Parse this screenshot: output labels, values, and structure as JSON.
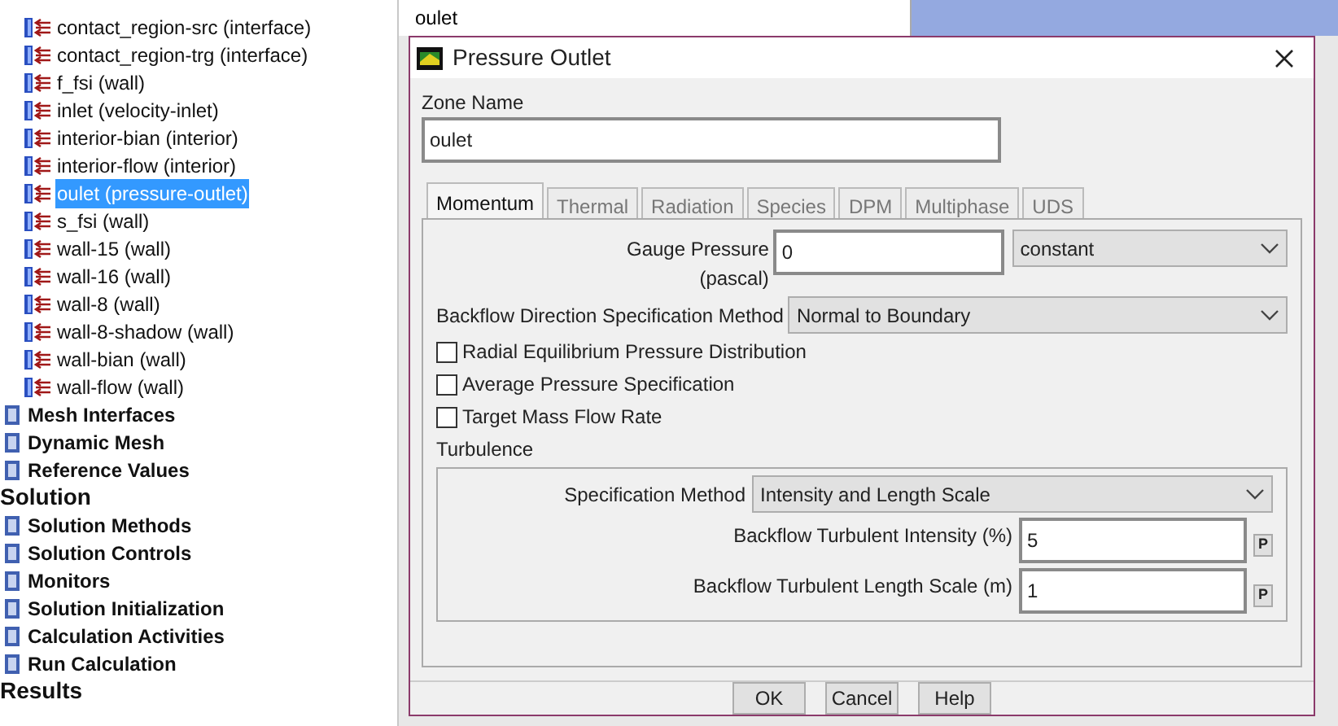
{
  "tree": {
    "items": [
      {
        "kind": "zone",
        "label": "contact_region-src (interface)",
        "selected": false
      },
      {
        "kind": "zone",
        "label": "contact_region-trg (interface)",
        "selected": false
      },
      {
        "kind": "zone",
        "label": "f_fsi (wall)",
        "selected": false
      },
      {
        "kind": "zone",
        "label": "inlet (velocity-inlet)",
        "selected": false
      },
      {
        "kind": "zone",
        "label": "interior-bian (interior)",
        "selected": false
      },
      {
        "kind": "zone",
        "label": "interior-flow (interior)",
        "selected": false
      },
      {
        "kind": "zone",
        "label": "oulet (pressure-outlet)",
        "selected": true
      },
      {
        "kind": "zone",
        "label": "s_fsi (wall)",
        "selected": false
      },
      {
        "kind": "zone",
        "label": "wall-15 (wall)",
        "selected": false
      },
      {
        "kind": "zone",
        "label": "wall-16 (wall)",
        "selected": false
      },
      {
        "kind": "zone",
        "label": "wall-8 (wall)",
        "selected": false
      },
      {
        "kind": "zone",
        "label": "wall-8-shadow (wall)",
        "selected": false
      },
      {
        "kind": "zone",
        "label": "wall-bian (wall)",
        "selected": false
      },
      {
        "kind": "zone",
        "label": "wall-flow (wall)",
        "selected": false
      },
      {
        "kind": "node",
        "label": "Mesh Interfaces",
        "selected": false
      },
      {
        "kind": "node",
        "label": "Dynamic Mesh",
        "selected": false
      },
      {
        "kind": "node",
        "label": "Reference Values",
        "selected": false
      },
      {
        "kind": "section",
        "label": "Solution",
        "selected": false
      },
      {
        "kind": "node",
        "label": "Solution Methods",
        "selected": false
      },
      {
        "kind": "node",
        "label": "Solution Controls",
        "selected": false
      },
      {
        "kind": "node",
        "label": "Monitors",
        "selected": false
      },
      {
        "kind": "node",
        "label": "Solution Initialization",
        "selected": false
      },
      {
        "kind": "node",
        "label": "Calculation Activities",
        "selected": false
      },
      {
        "kind": "node",
        "label": "Run Calculation",
        "selected": false
      },
      {
        "kind": "section",
        "label": "Results",
        "selected": false
      }
    ]
  },
  "background_list": {
    "value": "oulet"
  },
  "dialog": {
    "title": "Pressure Outlet",
    "zone_name": {
      "label": "Zone Name",
      "value": "oulet"
    },
    "tabs": [
      {
        "label": "Momentum",
        "selected": true
      },
      {
        "label": "Thermal",
        "selected": false
      },
      {
        "label": "Radiation",
        "selected": false
      },
      {
        "label": "Species",
        "selected": false
      },
      {
        "label": "DPM",
        "selected": false
      },
      {
        "label": "Multiphase",
        "selected": false
      },
      {
        "label": "UDS",
        "selected": false
      }
    ],
    "gauge_pressure": {
      "label": "Gauge Pressure (pascal)",
      "value": "0",
      "profile": "constant"
    },
    "backflow_direction": {
      "label": "Backflow Direction Specification Method",
      "value": "Normal to Boundary"
    },
    "checkboxes": [
      {
        "label": "Radial Equilibrium Pressure Distribution",
        "checked": false
      },
      {
        "label": "Average Pressure Specification",
        "checked": false
      },
      {
        "label": "Target Mass Flow Rate",
        "checked": false
      }
    ],
    "turbulence": {
      "title": "Turbulence",
      "method_label": "Specification Method",
      "method_value": "Intensity and Length Scale",
      "fields": [
        {
          "label": "Backflow Turbulent Intensity (%)",
          "value": "5",
          "param": "P"
        },
        {
          "label": "Backflow Turbulent Length Scale (m)",
          "value": "1",
          "param": "P"
        }
      ]
    },
    "buttons": [
      "OK",
      "Cancel",
      "Help"
    ]
  }
}
